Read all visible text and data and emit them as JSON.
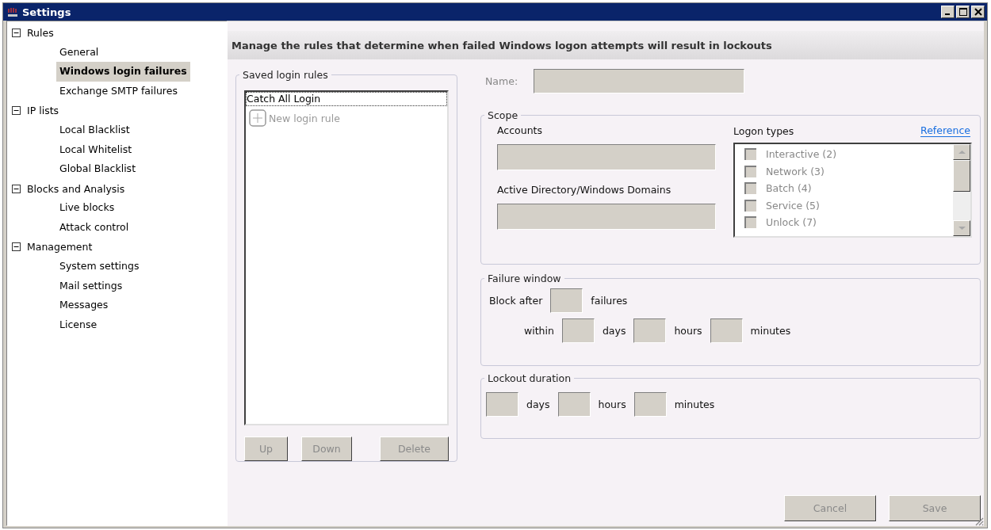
{
  "window": {
    "title": "Settings"
  },
  "sidebar": {
    "items": [
      {
        "label": "Rules",
        "expanded": true,
        "selected": false,
        "children": [
          {
            "label": "General",
            "selected": false
          },
          {
            "label": "Windows login failures",
            "selected": true
          },
          {
            "label": "Exchange SMTP failures",
            "selected": false
          }
        ]
      },
      {
        "label": "IP lists",
        "expanded": true,
        "selected": false,
        "children": [
          {
            "label": "Local Blacklist",
            "selected": false
          },
          {
            "label": "Local Whitelist",
            "selected": false
          },
          {
            "label": "Global Blacklist",
            "selected": false
          }
        ]
      },
      {
        "label": "Blocks and Analysis",
        "expanded": true,
        "selected": false,
        "children": [
          {
            "label": "Live blocks",
            "selected": false
          },
          {
            "label": "Attack control",
            "selected": false
          }
        ]
      },
      {
        "label": "Management",
        "expanded": true,
        "selected": false,
        "children": [
          {
            "label": "System settings",
            "selected": false
          },
          {
            "label": "Mail settings",
            "selected": false
          },
          {
            "label": "Messages",
            "selected": false
          },
          {
            "label": "License",
            "selected": false
          }
        ]
      }
    ]
  },
  "header": "Manage the rules that determine when failed Windows logon attempts will result in lockouts",
  "saved_rules": {
    "title": "Saved login rules",
    "items": [
      {
        "label": "Catch All Login",
        "selected": true
      }
    ],
    "new_item": "New login rule",
    "buttons": [
      {
        "label": "Up",
        "disabled": true
      },
      {
        "label": "Down",
        "disabled": true
      },
      {
        "label": "Delete",
        "disabled": true
      }
    ]
  },
  "name": {
    "label": "Name:"
  },
  "scope": {
    "title": "Scope",
    "accounts_label": "Accounts",
    "domains_label": "Active Directory/Windows Domains",
    "logon_types_label": "Logon types",
    "reference_link": "Reference",
    "logon_types": [
      {
        "label": "Interactive (2)",
        "checked": false
      },
      {
        "label": "Network (3)",
        "checked": false
      },
      {
        "label": "Batch (4)",
        "checked": false
      },
      {
        "label": "Service (5)",
        "checked": false
      },
      {
        "label": "Unlock (7)",
        "checked": false
      }
    ]
  },
  "failure_window": {
    "title": "Failure window",
    "block_after": "Block after",
    "failures": "failures",
    "within": "within",
    "days": "days",
    "hours": "hours",
    "minutes": "minutes"
  },
  "lockout_duration": {
    "title": "Lockout duration",
    "days": "days",
    "hours": "hours",
    "minutes": "minutes"
  },
  "buttons": [
    {
      "label": "Cancel",
      "disabled": true
    },
    {
      "label": "Save",
      "disabled": true
    }
  ]
}
